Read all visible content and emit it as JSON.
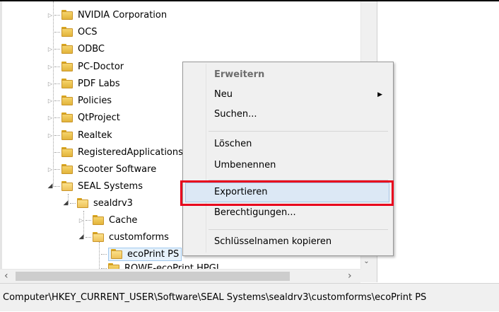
{
  "tree": {
    "items": [
      {
        "label": "NVIDIA Corporation",
        "expandable": true
      },
      {
        "label": "OCS",
        "expandable": false
      },
      {
        "label": "ODBC",
        "expandable": true
      },
      {
        "label": "PC-Doctor",
        "expandable": true
      },
      {
        "label": "PDF Labs",
        "expandable": true
      },
      {
        "label": "Policies",
        "expandable": true
      },
      {
        "label": "QtProject",
        "expandable": true
      },
      {
        "label": "Realtek",
        "expandable": true
      },
      {
        "label": "RegisteredApplications",
        "expandable": false
      },
      {
        "label": "Scooter Software",
        "expandable": true
      },
      {
        "label": "SEAL Systems",
        "expandable": true,
        "expanded": true
      },
      {
        "label": "sealdrv3",
        "expandable": true,
        "expanded": true
      },
      {
        "label": "Cache",
        "expandable": true
      },
      {
        "label": "customforms",
        "expandable": true,
        "expanded": true
      },
      {
        "label": "ecoPrint PS",
        "selected": true
      },
      {
        "label": "ROWE-ecoPrint HPGL"
      }
    ]
  },
  "context_menu": {
    "items": [
      {
        "label": "Erweitern",
        "default": true
      },
      {
        "label": "Neu",
        "submenu": true
      },
      {
        "label": "Suchen..."
      },
      {
        "label": "Löschen"
      },
      {
        "label": "Umbenennen"
      },
      {
        "label": "Exportieren",
        "highlighted": true
      },
      {
        "label": "Berechtigungen..."
      },
      {
        "label": "Schlüsselnamen kopieren"
      }
    ]
  },
  "status_bar": {
    "path": "Computer\\HKEY_CURRENT_USER\\Software\\SEAL Systems\\sealdrv3\\customforms\\ecoPrint PS"
  },
  "colors": {
    "highlight_border": "#e8001c",
    "menu_hover": "#dce8f5",
    "folder": "#f2c94c"
  }
}
